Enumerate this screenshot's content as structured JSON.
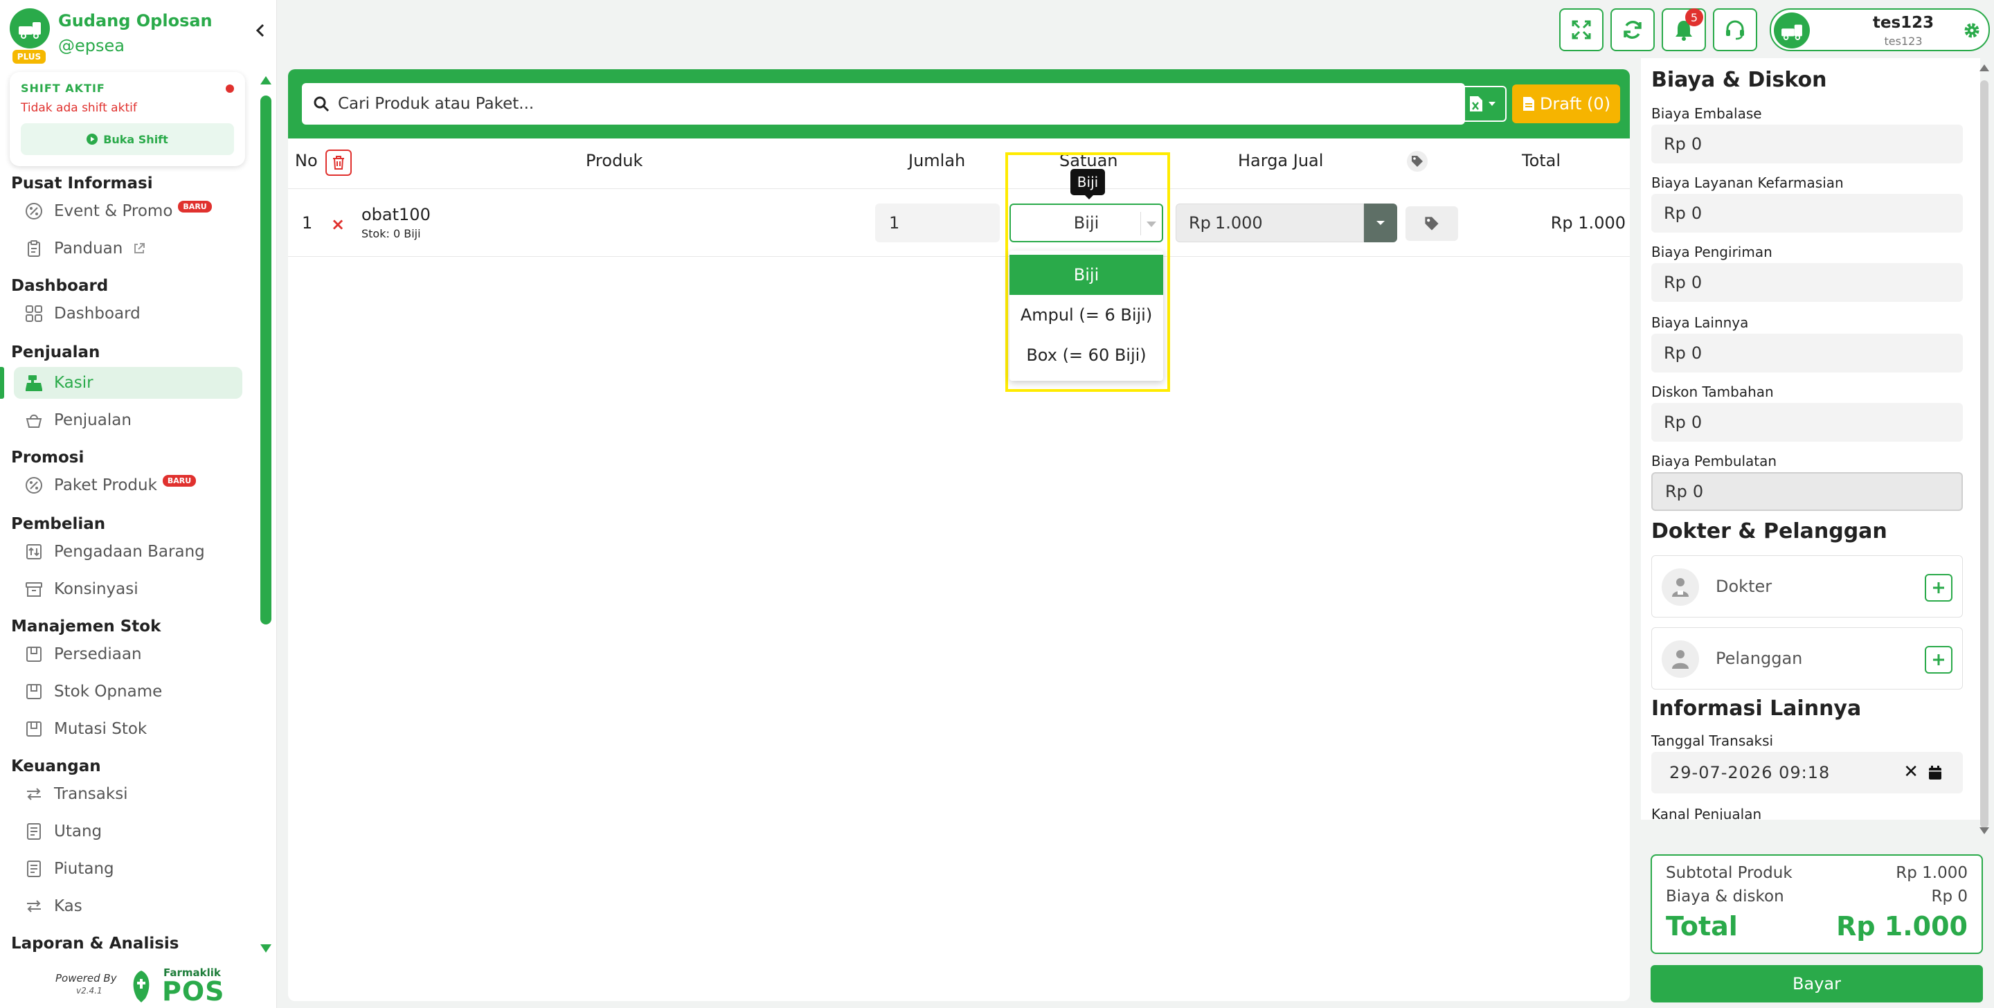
{
  "brand": {
    "name": "Gudang Oplosan",
    "handle": "@epsea",
    "tier": "PLUS"
  },
  "shift": {
    "title": "SHIFT AKTIF",
    "status": "Tidak ada shift aktif",
    "button": "Buka Shift"
  },
  "nav": {
    "sec_info": "Pusat Informasi",
    "event": "Event & Promo",
    "event_badge": "BARU",
    "panduan": "Panduan",
    "sec_dashboard": "Dashboard",
    "dashboard": "Dashboard",
    "sec_penjualan": "Penjualan",
    "kasir": "Kasir",
    "penjualan": "Penjualan",
    "sec_promosi": "Promosi",
    "paket": "Paket Produk",
    "paket_badge": "BARU",
    "sec_pembelian": "Pembelian",
    "pengadaan": "Pengadaan Barang",
    "konsinyasi": "Konsinyasi",
    "sec_stok": "Manajemen Stok",
    "persediaan": "Persediaan",
    "opname": "Stok Opname",
    "mutasi": "Mutasi Stok",
    "sec_keuangan": "Keuangan",
    "transaksi": "Transaksi",
    "utang": "Utang",
    "piutang": "Piutang",
    "kas": "Kas",
    "sec_laporan": "Laporan & Analisis"
  },
  "powered": {
    "by": "Powered By",
    "version": "v2.4.1",
    "brand_small": "Farmaklik",
    "brand_big": "POS"
  },
  "topbar": {
    "notif_count": "5",
    "user_name": "tes123",
    "user_sub": "tes123"
  },
  "search": {
    "placeholder": "Cari Produk atau Paket...",
    "draft_label": "Draft (0)"
  },
  "table": {
    "headers": {
      "no": "No",
      "produk": "Produk",
      "jumlah": "Jumlah",
      "satuan": "Satuan",
      "harga": "Harga Jual",
      "total": "Total"
    },
    "row": {
      "no": "1",
      "remove": "×",
      "name": "obat100",
      "stock": "Stok: 0 Biji",
      "qty": "1",
      "unit": "Biji",
      "price_prefix": "Rp",
      "price": "1.000",
      "total": "Rp 1.000"
    }
  },
  "satuan_dropdown": {
    "tooltip": "Biji",
    "options": [
      "Biji",
      "Ampul (= 6 Biji)",
      "Box (= 60 Biji)"
    ]
  },
  "right_panel": {
    "biaya_title": "Biaya & Diskon",
    "embalase_label": "Biaya Embalase",
    "layanan_label": "Biaya Layanan Kefarmasian",
    "pengiriman_label": "Biaya Pengiriman",
    "lainnya_label": "Biaya Lainnya",
    "diskon_label": "Diskon Tambahan",
    "pembulatan_label": "Biaya Pembulatan",
    "currency": "Rp",
    "zero": "0",
    "dp_title": "Dokter & Pelanggan",
    "dokter": "Dokter",
    "pelanggan": "Pelanggan",
    "info_title": "Informasi Lainnya",
    "tanggal_label": "Tanggal Transaksi",
    "tanggal_value": "29-07-2026 09:18",
    "kanal_label": "Kanal Penjualan"
  },
  "summary": {
    "subtotal_label": "Subtotal Produk",
    "subtotal_value": "Rp 1.000",
    "biaya_label": "Biaya & diskon",
    "biaya_value": "Rp 0",
    "total_label": "Total",
    "total_value": "Rp 1.000",
    "pay_button": "Bayar"
  },
  "colors": {
    "primary": "#2aaa4a",
    "danger": "#e0312e",
    "warning": "#f6b400",
    "highlight": "#ffeb00"
  }
}
